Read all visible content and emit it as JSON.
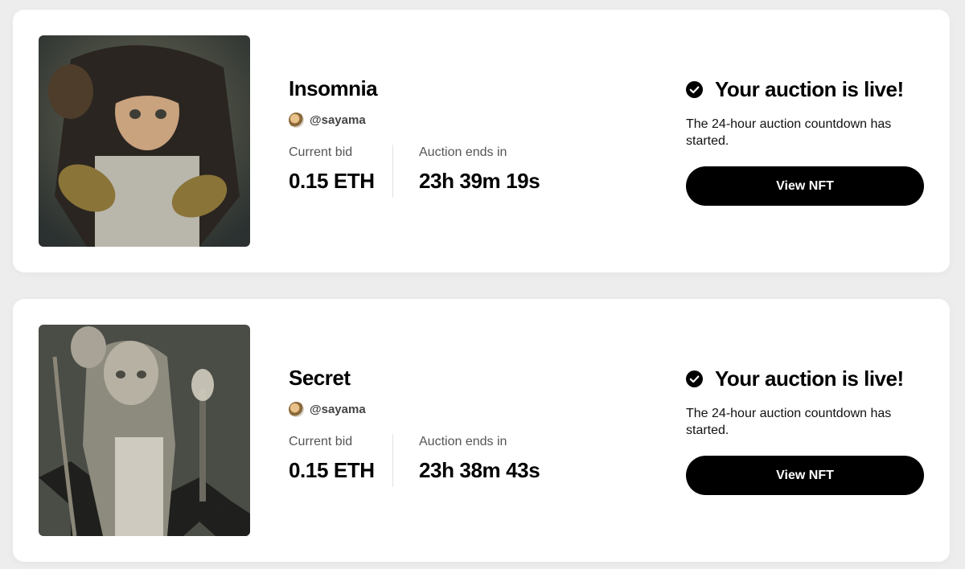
{
  "auctions": [
    {
      "title": "Insomnia",
      "creator": "@sayama",
      "current_bid_label": "Current bid",
      "current_bid": "0.15 ETH",
      "ends_label": "Auction ends in",
      "ends_in": "23h 39m 19s",
      "status_title": "Your auction is live!",
      "status_text": "The 24-hour auction countdown has started.",
      "button_label": "View NFT"
    },
    {
      "title": "Secret",
      "creator": "@sayama",
      "current_bid_label": "Current bid",
      "current_bid": "0.15 ETH",
      "ends_label": "Auction ends in",
      "ends_in": "23h 38m 43s",
      "status_title": "Your auction is live!",
      "status_text": "The 24-hour auction countdown has started.",
      "button_label": "View NFT"
    }
  ],
  "colors": {
    "button_bg": "#000000",
    "card_bg": "#ffffff",
    "page_bg": "#ededed"
  }
}
